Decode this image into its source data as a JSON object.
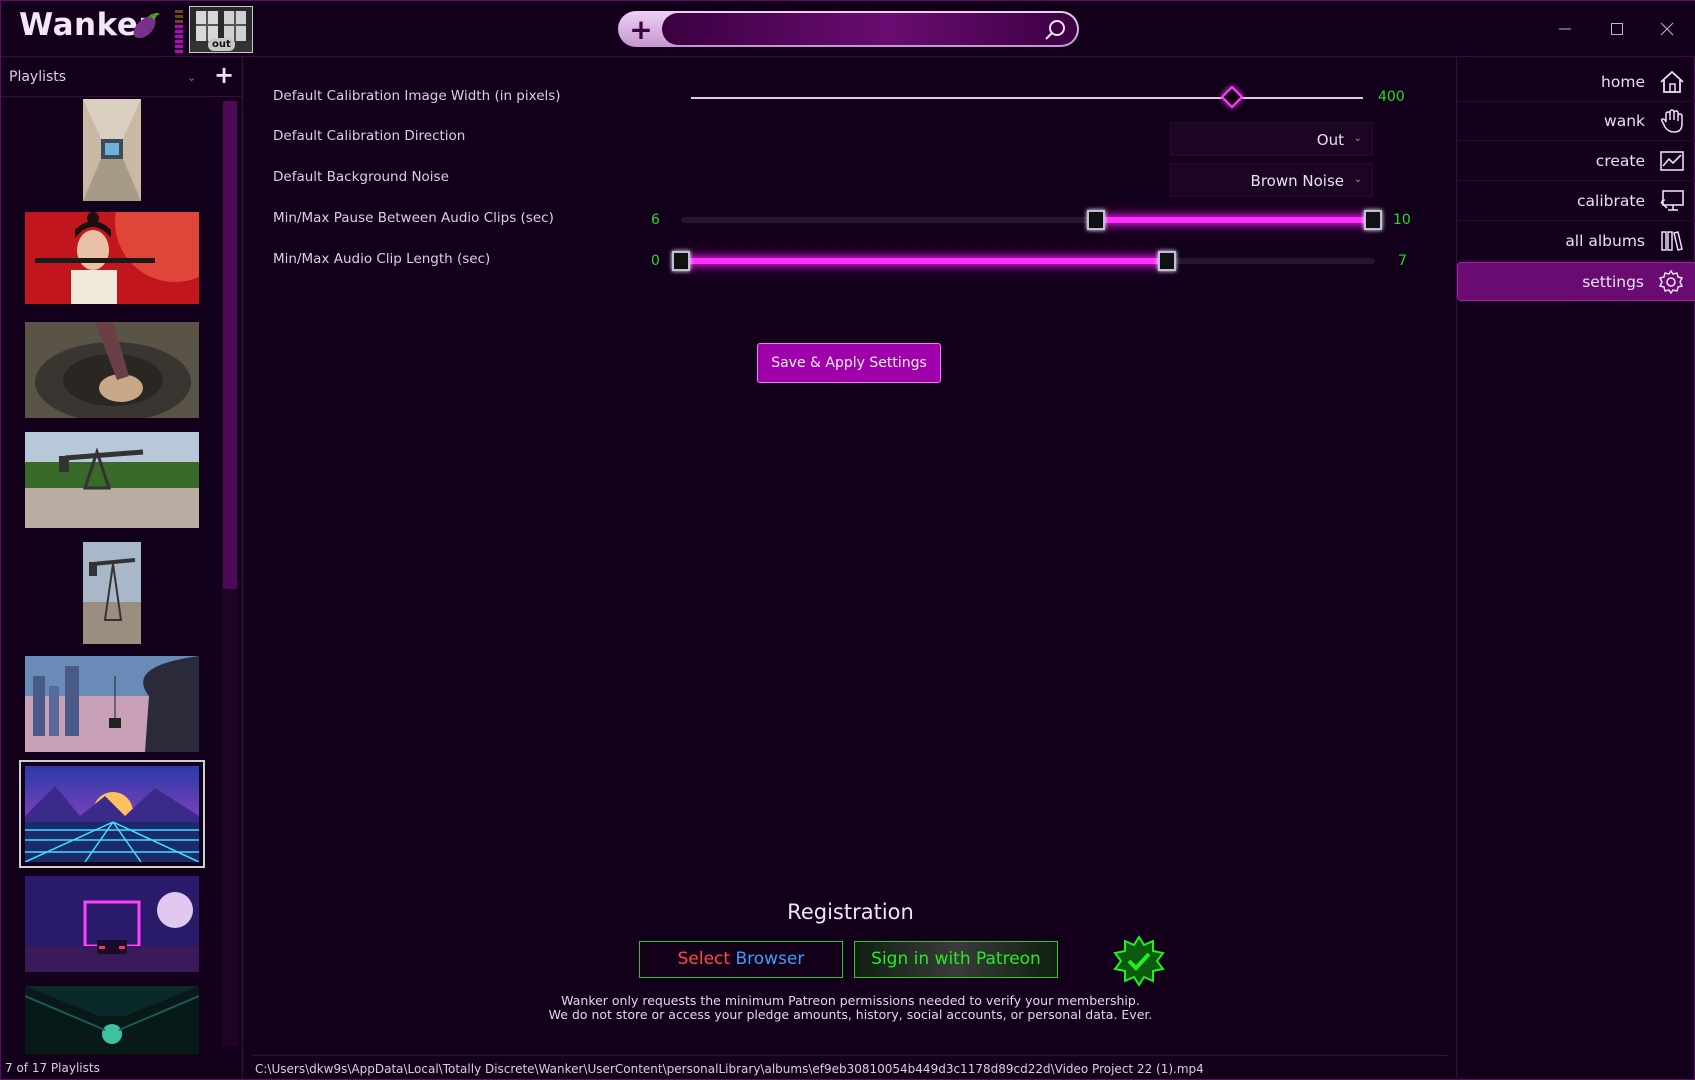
{
  "app": {
    "logo_text": "Wanker",
    "preview_badge": "out"
  },
  "search": {
    "placeholder": "",
    "add_label": "+"
  },
  "sidebar": {
    "header_label": "Playlists",
    "add_label": "+",
    "status": "7 of 17 Playlists",
    "selected_index": 6
  },
  "settings": [
    {
      "label": "Default Calibration Image Width (in pixels)",
      "type": "slider",
      "value": "400"
    },
    {
      "label": "Default Calibration Direction",
      "type": "dropdown",
      "value": "Out"
    },
    {
      "label": "Default Background Noise",
      "type": "dropdown",
      "value": "Brown Noise"
    },
    {
      "label": "Min/Max Pause Between Audio Clips (sec)",
      "type": "range",
      "min_value": "6",
      "max_value": "10"
    },
    {
      "label": "Min/Max Audio Clip Length (sec)",
      "type": "range",
      "min_value": "0",
      "max_value": "7"
    }
  ],
  "save_button": "Save & Apply Settings",
  "registration": {
    "title": "Registration",
    "select_word": "Select",
    "browser_word": "Browser",
    "patreon_button": "Sign in with Patreon",
    "note_line1": "Wanker only requests the minimum Patreon permissions needed to verify your membership.",
    "note_line2": "We do not store or access your pledge amounts, history, social accounts, or personal data. Ever."
  },
  "path": "C:\\Users\\dkw9s\\AppData\\Local\\Totally Discrete\\Wanker\\UserContent\\personalLibrary\\albums\\ef9eb30810054b449d3c1178d89cd22d\\Video Project 22 (1).mp4",
  "nav": [
    {
      "label": "home",
      "icon": "home-icon"
    },
    {
      "label": "wank",
      "icon": "hand-icon"
    },
    {
      "label": "create",
      "icon": "chart-icon"
    },
    {
      "label": "calibrate",
      "icon": "monitor-wrench-icon"
    },
    {
      "label": "all albums",
      "icon": "books-icon"
    },
    {
      "label": "settings",
      "icon": "gear-icon",
      "active": true
    }
  ],
  "colors": {
    "accent": "#a000aa",
    "neon": "#ff2fff",
    "value_green": "#22dd22",
    "background": "#13001a"
  }
}
